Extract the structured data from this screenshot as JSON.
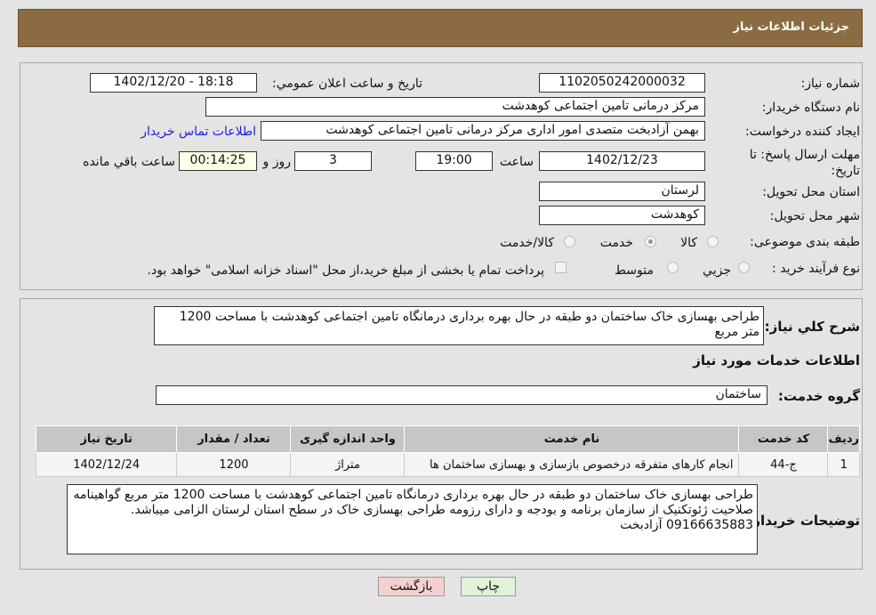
{
  "header": {
    "title": "جزئیات اطلاعات نیاز"
  },
  "form": {
    "need_number_label": "شماره نیاز:",
    "need_number": "1102050242000032",
    "announce_label": "تاریخ و ساعت اعلان عمومي:",
    "announce_value": "1402/12/20 - 18:18",
    "buyer_org_label": "نام دستگاه خریدار:",
    "buyer_org": "مرکز درمانی تامین اجتماعی کوهدشت",
    "creator_label": "ایجاد کننده درخواست:",
    "creator": "بهمن آزادبخت متصدی امور اداری  مرکز درمانی تامین اجتماعی کوهدشت",
    "contact_link": "اطلاعات تماس خریدار",
    "deadline_label": "مهلت ارسال پاسخ: تا تاریخ:",
    "deadline_date": "1402/12/23",
    "time_label": "ساعت",
    "deadline_time": "19:00",
    "days": "3",
    "days_label": "روز و",
    "remaining": "00:14:25",
    "remaining_label": "ساعت باقي مانده",
    "province_label": "استان محل تحویل:",
    "province": "لرستان",
    "city_label": "شهر محل تحویل:",
    "city": "کوهدشت",
    "category_label": "طبقه بندی موضوعی:",
    "category_options": [
      "کالا",
      "خدمت",
      "کالا/خدمت"
    ],
    "category_selected": "خدمت",
    "process_label": "نوع فرآیند خرید :",
    "process_options": [
      "جزیي",
      "متوسط"
    ],
    "payment_note": "پرداخت تمام یا بخشی از مبلغ خرید،از محل \"اسناد خزانه اسلامی\" خواهد بود."
  },
  "details": {
    "summary_label": "شرح کلي نیاز:",
    "summary": "طراحی بهسازی خاک ساختمان دو طبقه در حال بهره برداری درمانگاه تامین اجتماعی کوهدشت با مساحت 1200 متر مربع",
    "services_title": "اطلاعات خدمات مورد نیاز",
    "group_label": "گروه خدمت:",
    "group": "ساختمان",
    "table": {
      "headers": [
        "ردیف",
        "کد خدمت",
        "نام خدمت",
        "واحد اندازه گیری",
        "تعداد / مقدار",
        "تاریخ نیاز"
      ],
      "rows": [
        [
          "1",
          "ج-44",
          "انجام کارهای متفرقه درخصوص بازسازی و بهسازی ساختمان ها",
          "متراژ",
          "1200",
          "1402/12/24"
        ]
      ]
    },
    "buyer_notes_label": "توضیحات خریدار:",
    "buyer_notes": "طراحی بهسازی خاک ساختمان دو طبقه در حال بهره برداری درمانگاه تامین اجتماعی کوهدشت با مساحت 1200 متر مربع گواهینامه صلاحیت ژئوتکنیک از سازمان برنامه و بودجه و دارای رزومه طراحی بهسازی خاک در سطح استان لرستان الزامی میباشد. 09166635883 آزادبخت"
  },
  "buttons": {
    "print": "چاپ",
    "back": "بازگشت"
  },
  "colors": {
    "header": "#8b6c42",
    "link": "#2020e0",
    "back_button": "#f6d0d0",
    "print_button": "#e0f2d8"
  }
}
